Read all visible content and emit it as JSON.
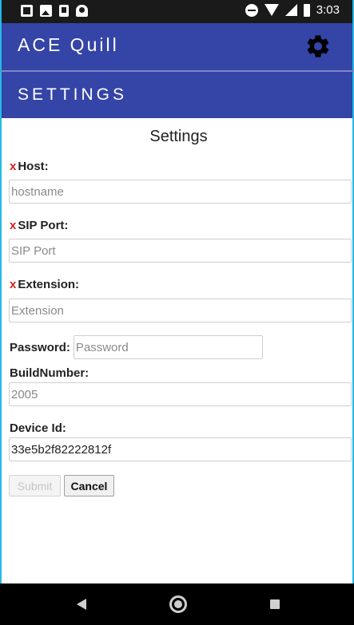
{
  "status_bar": {
    "time": "3:03",
    "left_icons": [
      "gallery-icon",
      "image-icon",
      "download-icon",
      "accessibility-icon"
    ],
    "right_icons": [
      "do-not-disturb-icon",
      "wifi-icon",
      "signal-icon",
      "battery-icon"
    ]
  },
  "app_bar": {
    "title": "ACE Quill",
    "settings_icon": "gear-icon",
    "color": "#3444a7"
  },
  "section": {
    "title": "SETTINGS"
  },
  "form": {
    "heading": "Settings",
    "required_marker": "x",
    "host": {
      "label": "Host:",
      "value": "",
      "placeholder": "hostname"
    },
    "sip_port": {
      "label": "SIP Port:",
      "value": "",
      "placeholder": "SIP Port"
    },
    "extension": {
      "label": "Extension:",
      "value": "",
      "placeholder": "Extension"
    },
    "password": {
      "label": "Password:",
      "value": "",
      "placeholder": "Password"
    },
    "build_number": {
      "label": "BuildNumber:",
      "value": "2005"
    },
    "device_id": {
      "label": "Device Id:",
      "value": "33e5b2f82222812f"
    },
    "submit_label": "Submit",
    "cancel_label": "Cancel"
  },
  "nav_bar": {
    "icons": [
      "back-icon",
      "home-icon",
      "recents-icon"
    ]
  },
  "colors": {
    "accent": "#3444a7",
    "required": "#d62020",
    "frame": "#23b9e6"
  }
}
